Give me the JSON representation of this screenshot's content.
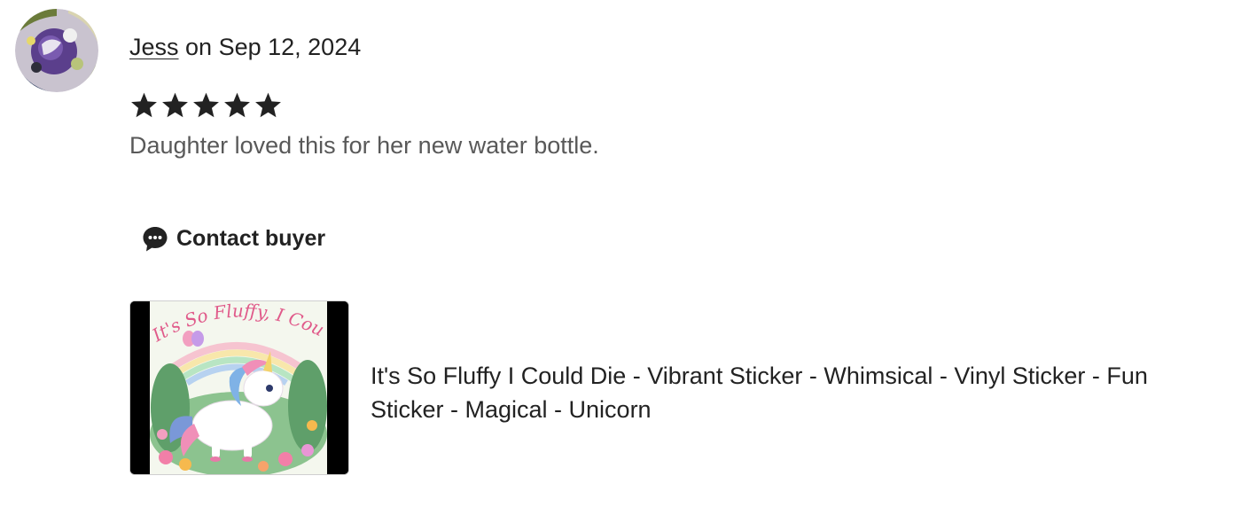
{
  "review": {
    "author": "Jess",
    "date_prefix": " on ",
    "date": "Sep 12, 2024",
    "rating": 5,
    "rating_max": 5,
    "text": "Daughter loved this for her new water bottle."
  },
  "actions": {
    "contact_label": "Contact buyer",
    "contact_icon": "chat-bubble-icon"
  },
  "listing": {
    "title": "It's So Fluffy I Could Die - Vibrant Sticker - Whimsical - Vinyl Sticker - Fun Sticker - Magical - Unicorn",
    "image_caption": "It's So Fluffy, I Could Die!"
  },
  "colors": {
    "text_primary": "#222222",
    "text_secondary": "#595959",
    "star": "#222222",
    "sticker_pink": "#e05a8a"
  }
}
